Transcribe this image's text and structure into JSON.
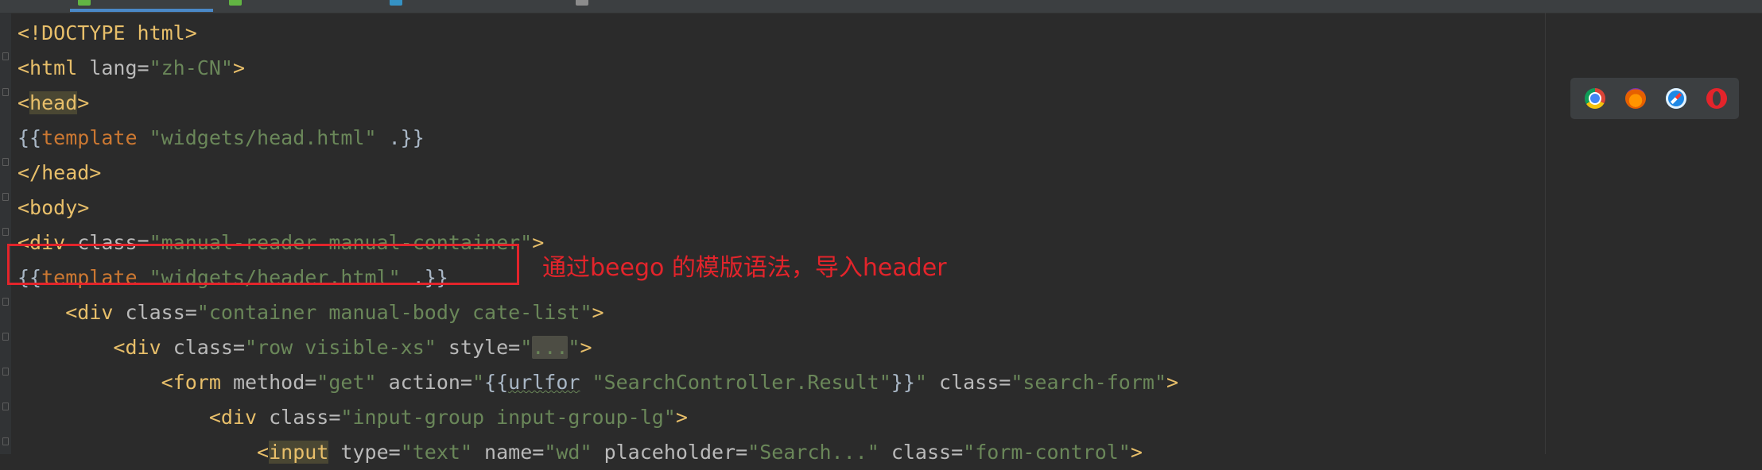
{
  "editor": {
    "lines": [
      [
        {
          "c": "tag",
          "t": "<!DOCTYPE html>"
        }
      ],
      [
        {
          "c": "tag",
          "t": "<html "
        },
        {
          "c": "attr",
          "t": "lang="
        },
        {
          "c": "str",
          "t": "\"zh-CN\""
        },
        {
          "c": "tag",
          "t": ">"
        }
      ],
      [
        {
          "c": "tag",
          "t": "<"
        },
        {
          "c": "tag-hl",
          "t": "head"
        },
        {
          "c": "tag",
          "t": ">"
        }
      ],
      [
        {
          "c": "plain",
          "t": "{{"
        },
        {
          "c": "kw",
          "t": "template "
        },
        {
          "c": "str",
          "t": "\"widgets/head.html\""
        },
        {
          "c": "plain",
          "t": " .}}"
        }
      ],
      [
        {
          "c": "tag",
          "t": "</head>"
        }
      ],
      [
        {
          "c": "tag",
          "t": "<body>"
        }
      ],
      [
        {
          "c": "tag",
          "t": "<div "
        },
        {
          "c": "attr",
          "t": "class="
        },
        {
          "c": "str",
          "t": "\"manual-reader manual-container\""
        },
        {
          "c": "tag",
          "t": ">"
        }
      ],
      [
        {
          "c": "plain",
          "t": "{{"
        },
        {
          "c": "kw",
          "t": "template "
        },
        {
          "c": "str",
          "t": "\"widgets/header.html\""
        },
        {
          "c": "plain",
          "t": " .}}"
        }
      ],
      [
        {
          "c": "plain",
          "t": "    "
        },
        {
          "c": "tag",
          "t": "<div "
        },
        {
          "c": "attr",
          "t": "class="
        },
        {
          "c": "str",
          "t": "\"container manual-body cate-list\""
        },
        {
          "c": "tag",
          "t": ">"
        }
      ],
      [
        {
          "c": "plain",
          "t": "        "
        },
        {
          "c": "tag",
          "t": "<div "
        },
        {
          "c": "attr",
          "t": "class="
        },
        {
          "c": "str",
          "t": "\"row visible-xs\" "
        },
        {
          "c": "attr",
          "t": "style="
        },
        {
          "c": "str",
          "t": "\""
        },
        {
          "c": "ellipsis",
          "t": "..."
        },
        {
          "c": "str",
          "t": "\""
        },
        {
          "c": "tag",
          "t": ">"
        }
      ],
      [
        {
          "c": "plain",
          "t": "            "
        },
        {
          "c": "tag",
          "t": "<form "
        },
        {
          "c": "attr",
          "t": "method="
        },
        {
          "c": "str",
          "t": "\"get\" "
        },
        {
          "c": "attr",
          "t": "action="
        },
        {
          "c": "str",
          "t": "\""
        },
        {
          "c": "plain",
          "t": "{{"
        },
        {
          "c": "fn",
          "t": "urlfor"
        },
        {
          "c": "str",
          "t": " \"SearchController.Result\""
        },
        {
          "c": "plain",
          "t": "}}"
        },
        {
          "c": "str",
          "t": "\" "
        },
        {
          "c": "attr",
          "t": "class="
        },
        {
          "c": "str",
          "t": "\"search-form\""
        },
        {
          "c": "tag",
          "t": ">"
        }
      ],
      [
        {
          "c": "plain",
          "t": "                "
        },
        {
          "c": "tag",
          "t": "<div "
        },
        {
          "c": "attr",
          "t": "class="
        },
        {
          "c": "str",
          "t": "\"input-group input-group-lg\""
        },
        {
          "c": "tag",
          "t": ">"
        }
      ],
      [
        {
          "c": "plain",
          "t": "                    "
        },
        {
          "c": "tag",
          "t": "<"
        },
        {
          "c": "tag-hl",
          "t": "input"
        },
        {
          "c": "tag",
          "t": " "
        },
        {
          "c": "attr",
          "t": "type="
        },
        {
          "c": "str",
          "t": "\"text\" "
        },
        {
          "c": "attr",
          "t": "name="
        },
        {
          "c": "str",
          "t": "\"wd\" "
        },
        {
          "c": "attr",
          "t": "placeholder="
        },
        {
          "c": "str",
          "t": "\"Search...\" "
        },
        {
          "c": "attr",
          "t": "class="
        },
        {
          "c": "str",
          "t": "\"form-control\""
        },
        {
          "c": "tag",
          "t": ">"
        }
      ]
    ]
  },
  "annotation": {
    "text": "通过beego 的模版语法，导入header",
    "color": "#e3242b"
  },
  "browser_icons": [
    "chrome-icon",
    "firefox-icon",
    "safari-icon",
    "opera-icon"
  ]
}
